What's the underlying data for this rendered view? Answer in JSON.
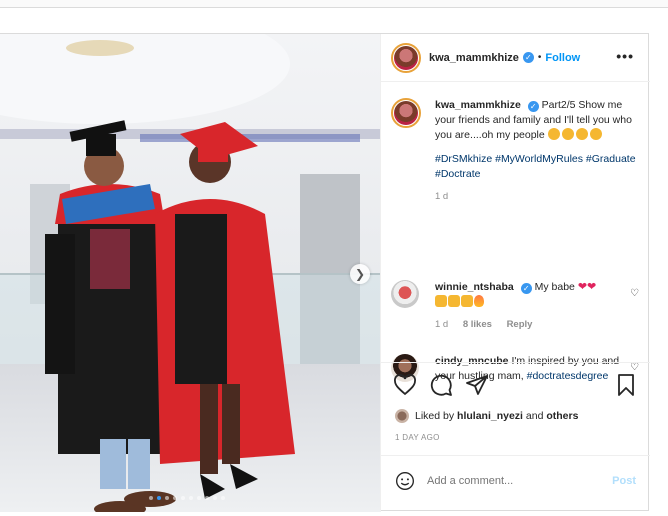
{
  "post": {
    "author": "kwa_mammkhize",
    "follow_label": "Follow",
    "separator": "•",
    "more_label": "•••",
    "verified_mark": "✓"
  },
  "caption": {
    "username": "kwa_mammkhize",
    "text": "Part2/5 Show me your friends and family and I'll tell you who you are....oh my people",
    "hashtags": "#DrSMkhize #MyWorldMyRules #Graduate #Doctrate",
    "time": "1 d"
  },
  "comments": [
    {
      "username": "winnie_ntshaba",
      "text": "My babe",
      "time": "1 d",
      "likes": "8 likes",
      "reply": "Reply"
    },
    {
      "username": "cindy_mncube",
      "text": "I'm inspired by you and your hustling mam,",
      "hashtag": "#doctratesdegree"
    }
  ],
  "liked_by": {
    "prefix": "Liked by",
    "user": "hlulani_nyezi",
    "joiner": "and",
    "others": "others"
  },
  "date_label": "1 DAY AGO",
  "comment_box": {
    "placeholder": "Add a comment...",
    "post_label": "Post"
  },
  "carousel": {
    "total_slides": 10,
    "active_index": 1
  },
  "colors": {
    "accent": "#0095f6",
    "verified": "#3897f0",
    "story_ring": "#e8a23a",
    "gown_red": "#d8262b",
    "gown_black": "#1a1a1a"
  },
  "icons": [
    "heart-icon",
    "comment-icon",
    "share-icon",
    "bookmark-icon",
    "smiley-icon",
    "more-icon",
    "chevron-right-icon",
    "verified-icon"
  ]
}
